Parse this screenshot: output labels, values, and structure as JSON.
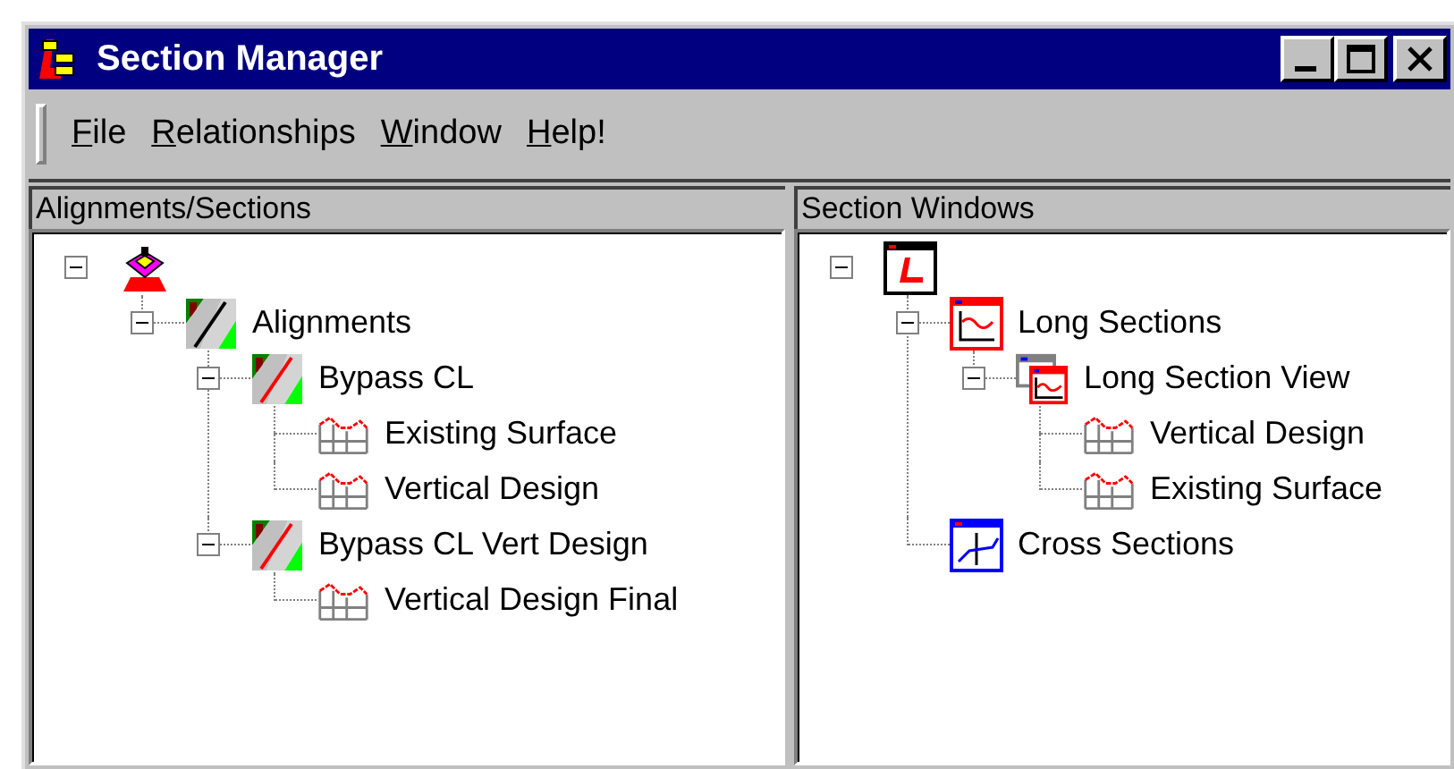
{
  "window": {
    "title": "Section Manager"
  },
  "menu": [
    {
      "label": "File"
    },
    {
      "label": "Relationships"
    },
    {
      "label": "Window"
    },
    {
      "label": "Help!"
    }
  ],
  "panels": [
    {
      "title": "Alignments/Sections",
      "tree": [
        {
          "kind": "project",
          "expanded": true,
          "children": [
            {
              "kind": "alignments",
              "label": "Alignments",
              "expanded": true,
              "children": [
                {
                  "kind": "alignment",
                  "label": "Bypass CL",
                  "expanded": true,
                  "children": [
                    {
                      "kind": "profile",
                      "label": "Existing Surface"
                    },
                    {
                      "kind": "profile",
                      "label": "Vertical Design"
                    }
                  ]
                },
                {
                  "kind": "alignment",
                  "label": "Bypass CL Vert Design",
                  "expanded": true,
                  "children": [
                    {
                      "kind": "profile",
                      "label": "Vertical Design Final"
                    }
                  ]
                }
              ]
            }
          ]
        }
      ]
    },
    {
      "title": "Section Windows",
      "tree": [
        {
          "kind": "window-root",
          "expanded": true,
          "children": [
            {
              "kind": "long-sections",
              "label": "Long Sections",
              "expanded": true,
              "children": [
                {
                  "kind": "long-section-view",
                  "label": "Long Section View",
                  "expanded": true,
                  "children": [
                    {
                      "kind": "profile",
                      "label": "Vertical Design"
                    },
                    {
                      "kind": "profile",
                      "label": "Existing Surface"
                    }
                  ]
                }
              ]
            },
            {
              "kind": "cross-sections",
              "label": "Cross Sections"
            }
          ]
        }
      ]
    }
  ]
}
